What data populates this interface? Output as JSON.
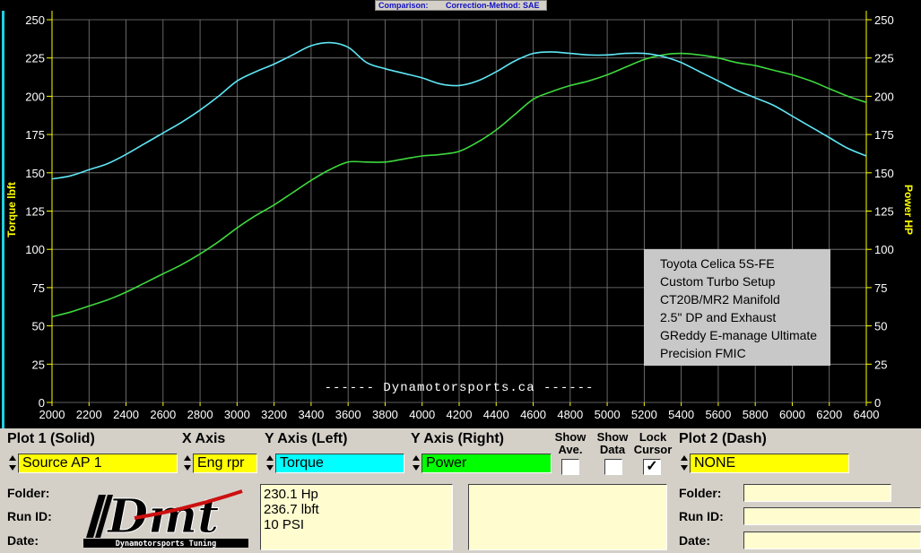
{
  "header": {
    "comparison_label": "Comparison:",
    "correction_label": "Correction-Method: SAE"
  },
  "chart_data": {
    "type": "line",
    "x": [
      2000,
      2100,
      2200,
      2300,
      2400,
      2500,
      2600,
      2700,
      2800,
      2900,
      3000,
      3100,
      3200,
      3300,
      3400,
      3500,
      3600,
      3700,
      3800,
      3900,
      4000,
      4100,
      4200,
      4300,
      4400,
      4500,
      4600,
      4700,
      4800,
      4900,
      5000,
      5100,
      5200,
      5300,
      5400,
      5500,
      5600,
      5700,
      5800,
      5900,
      6000,
      6100,
      6200,
      6300,
      6400
    ],
    "xlim": [
      2000,
      6400
    ],
    "x_ticks": [
      "2000",
      "2200",
      "2400",
      "2600",
      "2800",
      "3000",
      "3200",
      "3400",
      "3600",
      "3800",
      "4000",
      "4200",
      "4400",
      "4600",
      "4800",
      "5000",
      "5200",
      "5400",
      "5600",
      "5800",
      "6000",
      "6200",
      "6400"
    ],
    "y_left_label": "Torque lbft",
    "y_right_label": "Power HP",
    "ylim": [
      0,
      250
    ],
    "y_ticks": [
      "0",
      "25",
      "50",
      "75",
      "100",
      "125",
      "150",
      "175",
      "200",
      "225",
      "250"
    ],
    "grid": true,
    "series": [
      {
        "name": "Torque",
        "color": "#5fe6f5",
        "axis": "left",
        "values": [
          146,
          148,
          152,
          156,
          162,
          169,
          176,
          183,
          191,
          200,
          210,
          216,
          221,
          227,
          233,
          235,
          232,
          222,
          218,
          215,
          212,
          208,
          207,
          210,
          216,
          223,
          228,
          229,
          228,
          227,
          227,
          228,
          228,
          226,
          222,
          216,
          210,
          204,
          199,
          194,
          187,
          180,
          173,
          166,
          161
        ]
      },
      {
        "name": "Power",
        "color": "#3ed83e",
        "axis": "right",
        "values": [
          56,
          59,
          63,
          67,
          72,
          78,
          84,
          90,
          97,
          105,
          114,
          122,
          129,
          137,
          145,
          152,
          157,
          157,
          157,
          159,
          161,
          162,
          164,
          170,
          178,
          188,
          198,
          203,
          207,
          210,
          214,
          219,
          224,
          227,
          228,
          227,
          225,
          222,
          220,
          217,
          214,
          210,
          205,
          200,
          196
        ]
      }
    ],
    "annotation_lines": [
      "Toyota Celica 5S-FE",
      "Custom Turbo Setup",
      "CT20B/MR2 Manifold",
      "2.5\" DP and Exhaust",
      "GReddy E-manage Ultimate",
      "Precision FMIC"
    ],
    "watermark": "------  Dynamotorsports.ca  ------"
  },
  "panel": {
    "plot1_label": "Plot 1 (Solid)",
    "xaxis_label": "X Axis",
    "yleft_label": "Y Axis (Left)",
    "yright_label": "Y Axis (Right)",
    "show_ave_label": "Show Ave.",
    "show_data_label": "Show Data",
    "lock_cursor_label": "Lock Cursor",
    "plot2_label": "Plot 2 (Dash)",
    "plot1_value": "Source AP 1",
    "xaxis_value": "Eng rpr",
    "yleft_value": "Torque",
    "yright_value": "Power",
    "plot2_value": "NONE",
    "show_ave_checked": false,
    "show_data_checked": false,
    "lock_cursor_checked": true,
    "check_mark": "✓",
    "folder_label": "Folder:",
    "runid_label": "Run ID:",
    "date_label": "Date:",
    "results": [
      "230.1 Hp",
      "236.7 lbft",
      "10 PSI"
    ],
    "logo_text": "Dmt",
    "logo_caption": "Dynamotorsports Tuning",
    "colors": {
      "yellow": "#ffff00",
      "cyan": "#00ffff",
      "green": "#00ff00",
      "panel": "#d4d0c8",
      "field": "#fffcd0"
    }
  }
}
